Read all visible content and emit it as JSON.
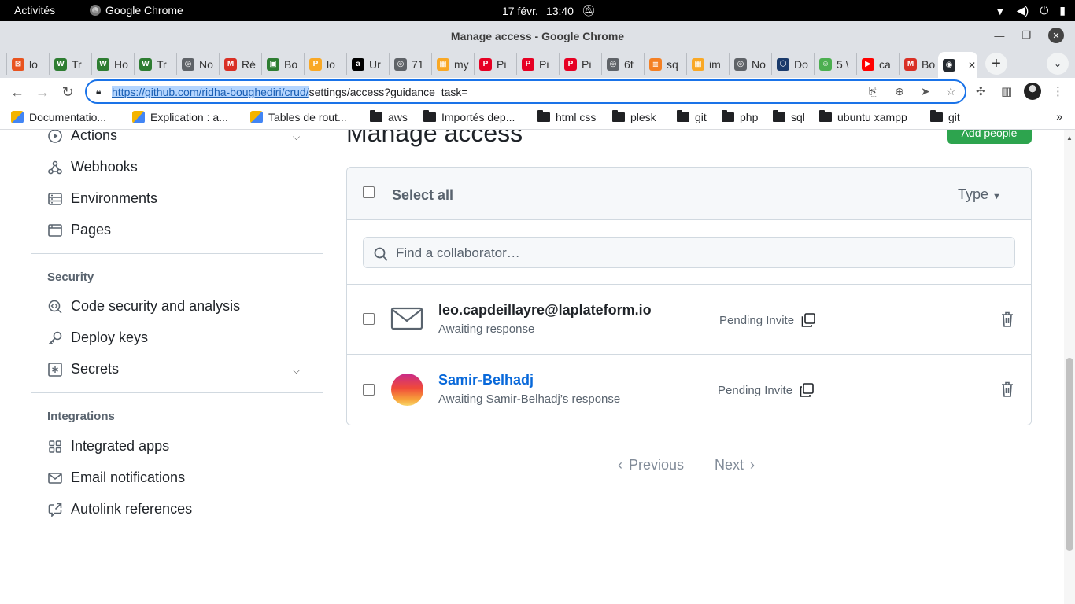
{
  "system": {
    "activities": "Activités",
    "app_name": "Google Chrome",
    "date": "17 févr.",
    "time": "13:40"
  },
  "window": {
    "title": "Manage access - Google Chrome"
  },
  "tabs": [
    {
      "label": "lo",
      "color": "#e8531f",
      "glyph": "⊠"
    },
    {
      "label": "Tr",
      "color": "#2e7d32",
      "glyph": "W"
    },
    {
      "label": "Ho",
      "color": "#2e7d32",
      "glyph": "W"
    },
    {
      "label": "Tr",
      "color": "#2e7d32",
      "glyph": "W"
    },
    {
      "label": "No",
      "color": "#5f6368",
      "glyph": "◎"
    },
    {
      "label": "Ré",
      "color": "#d93025",
      "glyph": "M"
    },
    {
      "label": "Bo",
      "color": "#2e7d32",
      "glyph": "▣"
    },
    {
      "label": "lo",
      "color": "#f9a825",
      "glyph": "P"
    },
    {
      "label": "Ur",
      "color": "#000000",
      "glyph": "a"
    },
    {
      "label": "71",
      "color": "#5f6368",
      "glyph": "◎"
    },
    {
      "label": "my",
      "color": "#f9a825",
      "glyph": "▦"
    },
    {
      "label": "Pi",
      "color": "#e60023",
      "glyph": "P"
    },
    {
      "label": "Pi",
      "color": "#e60023",
      "glyph": "P"
    },
    {
      "label": "Pi",
      "color": "#e60023",
      "glyph": "P"
    },
    {
      "label": "6f",
      "color": "#5f6368",
      "glyph": "◎"
    },
    {
      "label": "sq",
      "color": "#f48024",
      "glyph": "≣"
    },
    {
      "label": "im",
      "color": "#f9a825",
      "glyph": "▦"
    },
    {
      "label": "No",
      "color": "#5f6368",
      "glyph": "◎"
    },
    {
      "label": "Do",
      "color": "#1a3a6b",
      "glyph": "⬡"
    },
    {
      "label": "5 \\",
      "color": "#4caf50",
      "glyph": "☺"
    },
    {
      "label": "ca",
      "color": "#ff0000",
      "glyph": "▶"
    },
    {
      "label": "Bo",
      "color": "#d93025",
      "glyph": "M"
    },
    {
      "label": "",
      "color": "#24292f",
      "glyph": "◉"
    }
  ],
  "toolbar": {
    "url_selected": "https://github.com/ridha-boughediri/crud/",
    "url_rest": "settings/access?guidance_task="
  },
  "bookmarks": [
    {
      "label": "Documentatio...",
      "type": "page"
    },
    {
      "label": "Explication : a...",
      "type": "page"
    },
    {
      "label": "Tables de rout...",
      "type": "page"
    },
    {
      "label": "aws",
      "type": "folder"
    },
    {
      "label": "Importés dep...",
      "type": "folder"
    },
    {
      "label": "html css",
      "type": "folder"
    },
    {
      "label": "plesk",
      "type": "folder"
    },
    {
      "label": "git",
      "type": "folder"
    },
    {
      "label": "php",
      "type": "folder"
    },
    {
      "label": "sql",
      "type": "folder"
    },
    {
      "label": "ubuntu xampp",
      "type": "folder"
    },
    {
      "label": "git",
      "type": "folder"
    }
  ],
  "sidebar": {
    "actions": "Actions",
    "webhooks": "Webhooks",
    "environments": "Environments",
    "pages": "Pages",
    "security_heading": "Security",
    "code_security": "Code security and analysis",
    "deploy_keys": "Deploy keys",
    "secrets": "Secrets",
    "integrations_heading": "Integrations",
    "integrated_apps": "Integrated apps",
    "email_notifications": "Email notifications",
    "autolink_references": "Autolink references"
  },
  "main": {
    "title": "Manage access",
    "add_button": "Add people",
    "select_all": "Select all",
    "type_filter": "Type",
    "search_placeholder": "Find a collaborator…",
    "collaborators": [
      {
        "name": "leo.capdeillayre@laplateform.io",
        "sub": "Awaiting response",
        "status": "Pending Invite"
      },
      {
        "name": "Samir-Belhadj",
        "sub": "Awaiting Samir-Belhadj’s response",
        "status": "Pending Invite"
      }
    ],
    "pager": {
      "previous": "Previous",
      "next": "Next"
    }
  },
  "colors": {
    "accent": "#0969da",
    "button_green": "#2da44e",
    "focus_blue": "#1a73e8"
  }
}
